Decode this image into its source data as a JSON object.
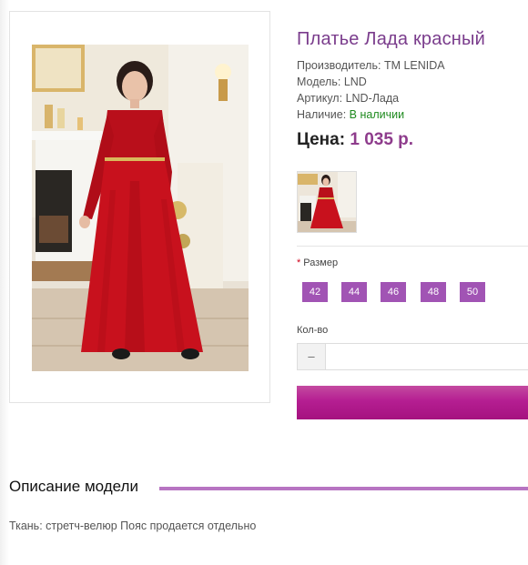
{
  "product": {
    "title": "Платье Лада красный",
    "manufacturer_label": "Производитель:",
    "manufacturer_value": "TM LENIDA",
    "model_label": "Модель:",
    "model_value": "LND",
    "sku_label": "Артикул:",
    "sku_value": "LND-Лада",
    "availability_label": "Наличие:",
    "availability_value": "В наличии",
    "price_label": "Цена:",
    "price_value": "1 035 р."
  },
  "options": {
    "size_label": "Размер",
    "required_mark": "*",
    "sizes": [
      "42",
      "44",
      "46",
      "48",
      "50"
    ]
  },
  "quantity": {
    "label": "Кол-во",
    "minus_label": "–",
    "value": ""
  },
  "description": {
    "heading": "Описание модели",
    "text": "Ткань: стретч-велюр Пояс продается отдельно"
  },
  "colors": {
    "accent": "#a154b4",
    "title": "#7a3c8c",
    "price": "#8e3c8c",
    "dress": "#c8111d",
    "in_stock": "#1e8a1e"
  }
}
